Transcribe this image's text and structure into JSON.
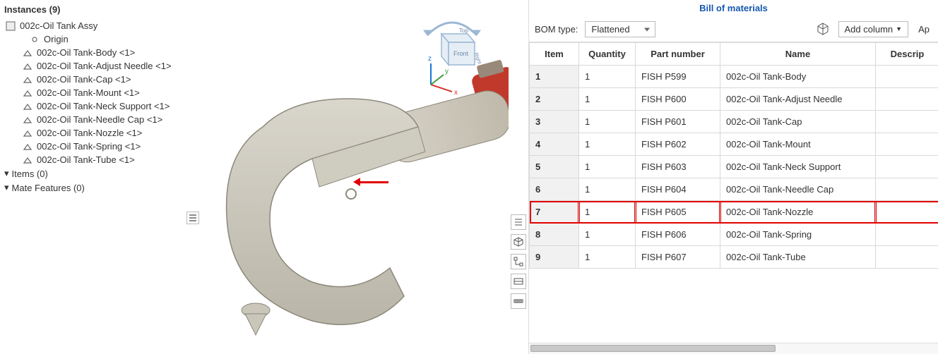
{
  "sidebar": {
    "header_prefix": "Instances",
    "count": 9,
    "root": "002c-Oil Tank Assy",
    "origin": "Origin",
    "parts": [
      "002c-Oil Tank-Body <1>",
      "002c-Oil Tank-Adjust Needle <1>",
      "002c-Oil Tank-Cap <1>",
      "002c-Oil Tank-Mount <1>",
      "002c-Oil Tank-Neck Support <1>",
      "002c-Oil Tank-Needle Cap <1>",
      "002c-Oil Tank-Nozzle <1>",
      "002c-Oil Tank-Spring <1>",
      "002c-Oil Tank-Tube <1>"
    ],
    "items_label": "Items (0)",
    "mate_label": "Mate Features (0)"
  },
  "viewcube": {
    "axes": {
      "x": "x",
      "y": "y",
      "z": "z"
    },
    "faces": {
      "front": "Front",
      "top": "Top",
      "right": "Right"
    }
  },
  "bom": {
    "title": "Bill of materials",
    "bom_type_label": "BOM type:",
    "bom_type_value": "Flattened",
    "add_column_label": "Add column",
    "apply_label": "Ap",
    "columns": [
      "Item",
      "Quantity",
      "Part number",
      "Name",
      "Descrip"
    ],
    "rows": [
      {
        "item": "1",
        "qty": "1",
        "pn": "FISH P599",
        "name": "002c-Oil Tank-Body",
        "desc": ""
      },
      {
        "item": "2",
        "qty": "1",
        "pn": "FISH P600",
        "name": "002c-Oil Tank-Adjust Needle",
        "desc": ""
      },
      {
        "item": "3",
        "qty": "1",
        "pn": "FISH P601",
        "name": "002c-Oil Tank-Cap",
        "desc": ""
      },
      {
        "item": "4",
        "qty": "1",
        "pn": "FISH P602",
        "name": "002c-Oil Tank-Mount",
        "desc": ""
      },
      {
        "item": "5",
        "qty": "1",
        "pn": "FISH P603",
        "name": "002c-Oil Tank-Neck Support",
        "desc": ""
      },
      {
        "item": "6",
        "qty": "1",
        "pn": "FISH P604",
        "name": "002c-Oil Tank-Needle Cap",
        "desc": ""
      },
      {
        "item": "7",
        "qty": "1",
        "pn": "FISH P605",
        "name": "002c-Oil Tank-Nozzle",
        "desc": ""
      },
      {
        "item": "8",
        "qty": "1",
        "pn": "FISH P606",
        "name": "002c-Oil Tank-Spring",
        "desc": ""
      },
      {
        "item": "9",
        "qty": "1",
        "pn": "FISH P607",
        "name": "002c-Oil Tank-Tube",
        "desc": ""
      }
    ],
    "highlight_item": "7"
  },
  "colors": {
    "accent_red": "#e20000",
    "link_blue": "#1558b0"
  }
}
